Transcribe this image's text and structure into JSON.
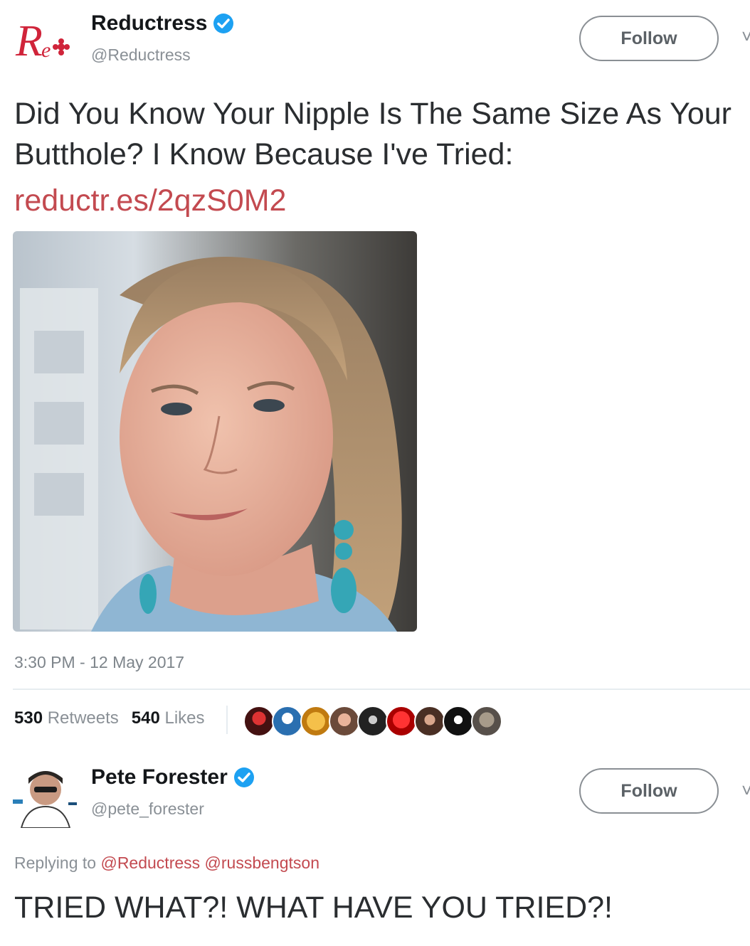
{
  "tweet": {
    "author_name": "Reductress",
    "author_handle": "@Reductress",
    "verified_icon": "verified-badge-icon",
    "logo_icon": "reductress-logo-icon",
    "follow_label": "Follow",
    "text": "Did You Know Your Nipple Is The Same Size As Your Butthole? I Know Because I've Tried:",
    "link": "reductr.es/2qzS0M2",
    "photo": "portrait-photo",
    "timestamp": "3:30 PM - 12 May 2017",
    "retweets_count": "530",
    "retweets_label": "Retweets",
    "likes_count": "540",
    "likes_label": "Likes",
    "liker_avatar_icons": [
      "avatar-icon",
      "avatar-icon",
      "avatar-icon",
      "avatar-icon",
      "avatar-icon",
      "avatar-icon",
      "avatar-icon",
      "avatar-icon",
      "avatar-icon"
    ]
  },
  "reply": {
    "author_name": "Pete Forester",
    "author_handle": "@pete_forester",
    "follow_label": "Follow",
    "replying_prefix": "Replying to",
    "mention_1": "@Reductress",
    "mention_2": "@russbengtson",
    "text": "TRIED WHAT?! WHAT HAVE YOU TRIED?!"
  },
  "colors": {
    "link": "#c34a50",
    "verified": "#1da1f2",
    "brand": "#d0243a"
  }
}
